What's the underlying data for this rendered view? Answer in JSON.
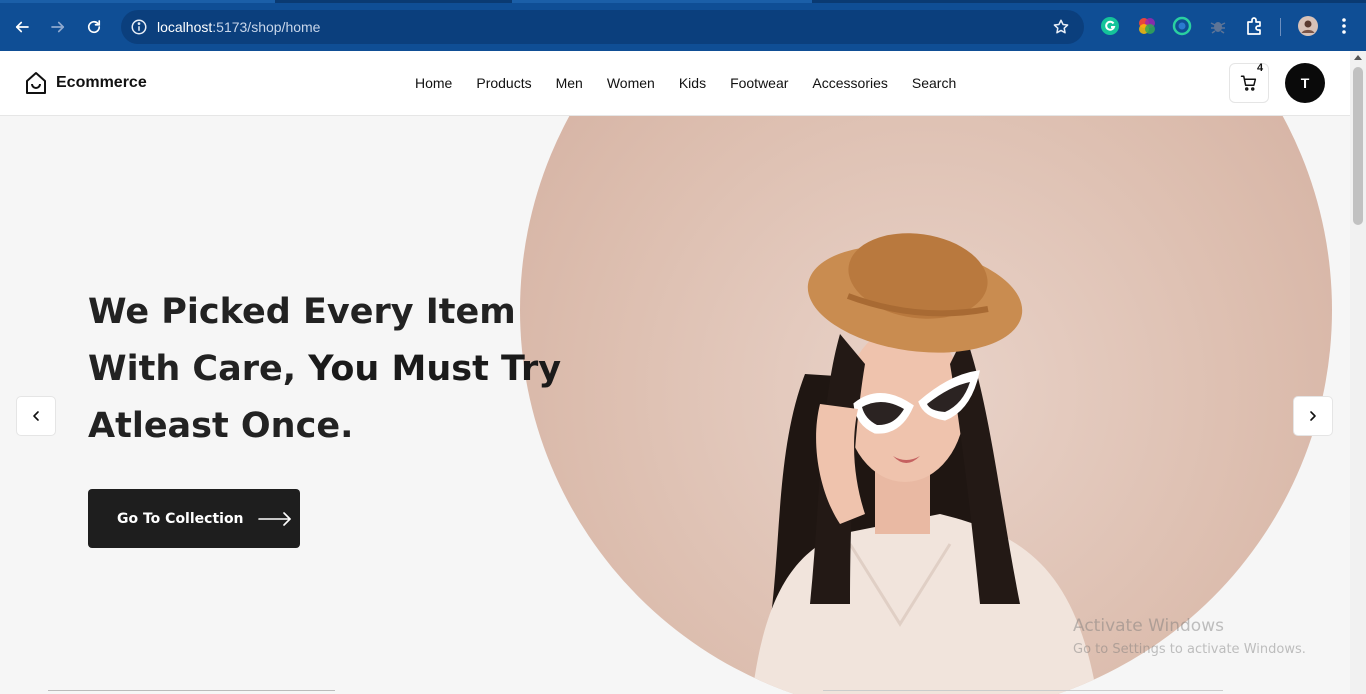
{
  "browser": {
    "url_host": "localhost",
    "url_path": ":5173/shop/home"
  },
  "header": {
    "logo_text": "Ecommerce",
    "nav": [
      "Home",
      "Products",
      "Men",
      "Women",
      "Kids",
      "Footwear",
      "Accessories",
      "Search"
    ],
    "cart_count": "4",
    "avatar_initial": "T"
  },
  "hero": {
    "title_line1": "We Picked Every Item",
    "title_line2_plain": "With Care, ",
    "title_line2_bold": "You Must Try",
    "title_line3": "Atleast Once.",
    "cta_label": "Go To Collection"
  },
  "watermark": {
    "line1": "Activate Windows",
    "line2": "Go to Settings to activate Windows."
  },
  "colors": {
    "browser_chrome": "#0f4e95",
    "cta_background": "#1e1e1e",
    "hero_background": "#f6f6f6"
  }
}
